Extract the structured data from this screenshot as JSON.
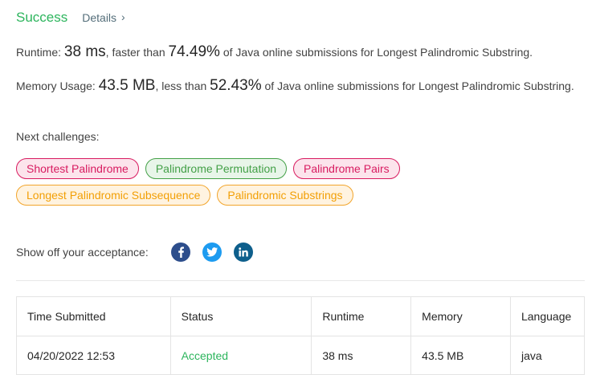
{
  "header": {
    "status": "Success",
    "details_label": "Details",
    "chevron": "›"
  },
  "runtime": {
    "label": "Runtime: ",
    "value": "38 ms",
    "middle": ", faster than ",
    "percent": "74.49%",
    "suffix": " of Java online submissions for Longest Palindromic Substring."
  },
  "memory": {
    "label": "Memory Usage: ",
    "value": "43.5 MB",
    "middle": ", less than ",
    "percent": "52.43%",
    "suffix": " of Java online submissions for Longest Palindromic Substring."
  },
  "next_challenges": {
    "label": "Next challenges:",
    "items": [
      {
        "label": "Shortest Palindrome",
        "difficulty": "hard"
      },
      {
        "label": "Palindrome Permutation",
        "difficulty": "easy"
      },
      {
        "label": "Palindrome Pairs",
        "difficulty": "hard"
      },
      {
        "label": "Longest Palindromic Subsequence",
        "difficulty": "medium"
      },
      {
        "label": "Palindromic Substrings",
        "difficulty": "medium"
      }
    ]
  },
  "share": {
    "label": "Show off your acceptance:",
    "icons": [
      "facebook-icon",
      "twitter-icon",
      "linkedin-icon"
    ]
  },
  "table": {
    "headers": [
      "Time Submitted",
      "Status",
      "Runtime",
      "Memory",
      "Language"
    ],
    "rows": [
      [
        "04/20/2022 12:53",
        "Accepted",
        "38 ms",
        "43.5 MB",
        "java"
      ]
    ]
  },
  "colors": {
    "success": "#2db55d",
    "hard": "#d81b60",
    "easy": "#43a047",
    "medium": "#f29f05"
  }
}
